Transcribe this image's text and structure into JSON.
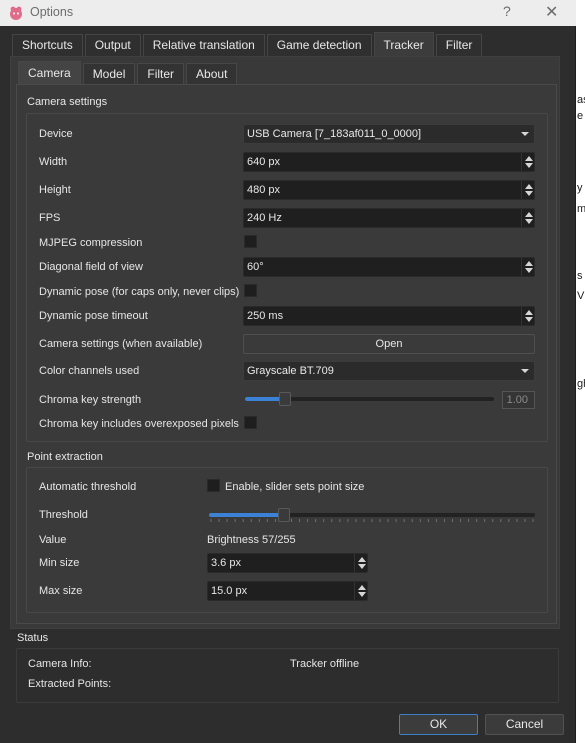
{
  "window": {
    "title": "Options",
    "help_glyph": "?",
    "close_glyph": "✕",
    "icon": "app-logo-icon"
  },
  "tabs": [
    "Shortcuts",
    "Output",
    "Relative translation",
    "Game detection",
    "Tracker",
    "Filter"
  ],
  "active_tab": "Tracker",
  "subtabs": [
    "Camera",
    "Model",
    "Filter",
    "About"
  ],
  "active_subtab": "Camera",
  "camera_settings": {
    "title": "Camera settings",
    "device_label": "Device",
    "device_value": "USB Camera [7_183af011_0_0000]",
    "width_label": "Width",
    "width_value": "640 px",
    "height_label": "Height",
    "height_value": "480 px",
    "fps_label": "FPS",
    "fps_value": "240 Hz",
    "mjpeg_label": "MJPEG compression",
    "mjpeg_checked": false,
    "fov_label": "Diagonal field of view",
    "fov_value": "60°",
    "dynamic_pose_label": "Dynamic pose (for caps only, never clips)",
    "dynamic_pose_checked": false,
    "dynamic_timeout_label": "Dynamic pose timeout",
    "dynamic_timeout_value": "250 ms",
    "cam_settings_label": "Camera settings (when available)",
    "open_button": "Open",
    "color_channels_label": "Color channels used",
    "color_channels_value": "Grayscale BT.709",
    "chroma_key_label": "Chroma key strength",
    "chroma_key_value": "1.00",
    "chroma_key_fraction": 0.16,
    "chroma_overexposed_label": "Chroma key includes overexposed pixels",
    "chroma_overexposed_checked": false
  },
  "point_extraction": {
    "title": "Point extraction",
    "auto_threshold_label": "Automatic threshold",
    "auto_threshold_checkbox_label": "Enable, slider sets point size",
    "auto_threshold_checked": false,
    "threshold_label": "Threshold",
    "threshold_fraction": 0.23,
    "value_label": "Value",
    "value_text": "Brightness 57/255",
    "min_size_label": "Min size",
    "min_size_value": "3.6 px",
    "max_size_label": "Max size",
    "max_size_value": "15.0 px"
  },
  "status": {
    "title": "Status",
    "camera_info_label": "Camera Info:",
    "camera_info_value": "Tracker offline",
    "extracted_points_label": "Extracted Points:"
  },
  "buttons": {
    "ok": "OK",
    "cancel": "Cancel"
  },
  "colors": {
    "window_bg": "#2d2d2d",
    "accent": "#3b82d6",
    "field_bg": "#1f1f1f"
  }
}
